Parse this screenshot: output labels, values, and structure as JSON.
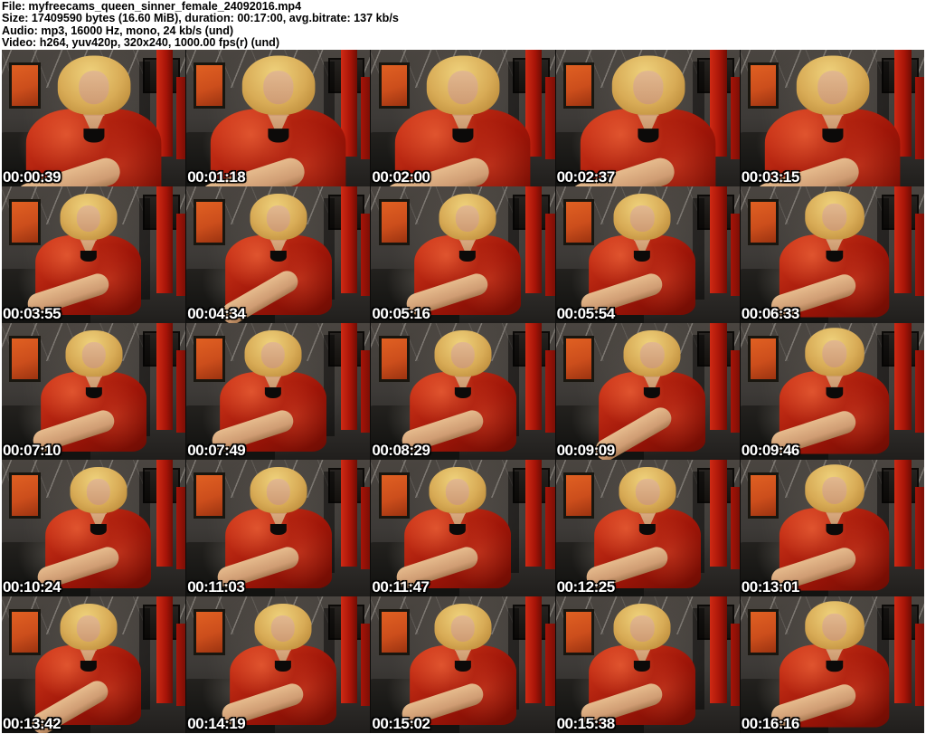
{
  "header": {
    "lines": [
      "File: myfreecams_queen_sinner_female_24092016.mp4",
      "Size: 17409590 bytes (16.60 MiB), duration: 00:17:00, avg.bitrate: 137 kb/s",
      "Audio: mp3, 16000 Hz, mono, 24 kb/s (und)",
      "Video: h264, yuv420p, 320x240, 1000.00 fps(r) (und)"
    ],
    "file_name": "myfreecams_queen_sinner_female_24092016.mp4",
    "size_bytes": "17409590",
    "size_human": "16.60 MiB",
    "duration": "00:17:00",
    "avg_bitrate": "137 kb/s",
    "audio_codec": "mp3",
    "audio_sample_rate": "16000 Hz",
    "audio_channels": "mono",
    "audio_bitrate": "24 kb/s",
    "video_codec": "h264",
    "pixel_format": "yuv420p",
    "resolution": "320x240",
    "frame_rate": "1000.00 fps(r)"
  },
  "grid": {
    "rows": 5,
    "cols": 5,
    "timestamps": [
      "00:00:39",
      "00:01:18",
      "00:02:00",
      "00:02:37",
      "00:03:15",
      "00:03:55",
      "00:04:34",
      "00:05:16",
      "00:05:54",
      "00:06:33",
      "00:07:10",
      "00:07:49",
      "00:08:29",
      "00:09:09",
      "00:09:46",
      "00:10:24",
      "00:11:03",
      "00:11:47",
      "00:12:25",
      "00:13:01",
      "00:13:42",
      "00:14:19",
      "00:15:02",
      "00:15:38",
      "00:16:16"
    ]
  },
  "colors": {
    "page_bg": "#ffffff",
    "header_text": "#000000",
    "timestamp_text": "#ffffff",
    "timestamp_outline": "#000000",
    "scene_wall": "#3d3a37",
    "scene_wall_dark": "#201e1c",
    "scene_panel_orange": "#cc4e1c",
    "scene_frame_red": "#a61408",
    "scene_blouse": "#9e1508",
    "scene_blouse_light": "#d63b1c",
    "scene_hair": "#d8ab56",
    "scene_skin": "#cf9c73",
    "scene_couch": "#131311"
  }
}
